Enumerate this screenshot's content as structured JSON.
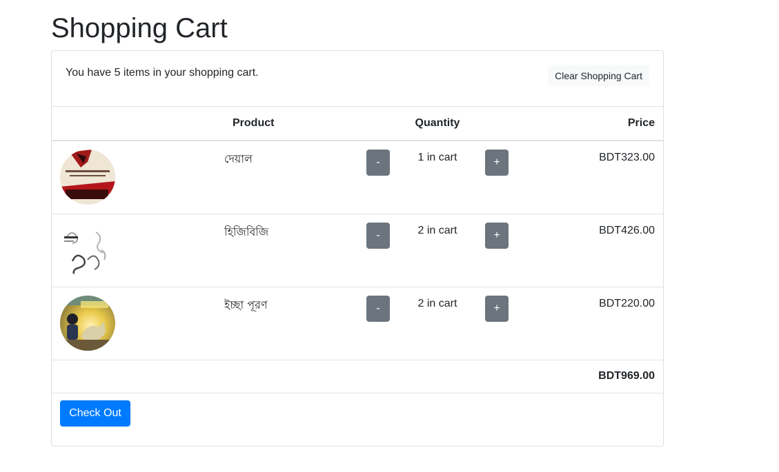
{
  "page": {
    "title": "Shopping Cart"
  },
  "cart": {
    "summary": "You have 5 items in your shopping cart.",
    "clear_label": "Clear Shopping Cart",
    "columns": {
      "product": "Product",
      "quantity": "Quantity",
      "price": "Price"
    },
    "items": [
      {
        "name": "দেয়াল",
        "quantity_text": "1 in cart",
        "price": "BDT323.00",
        "minus": "-",
        "plus": "+"
      },
      {
        "name": "হিজিবিজি",
        "quantity_text": "2 in cart",
        "price": "BDT426.00",
        "minus": "-",
        "plus": "+"
      },
      {
        "name": "ইচ্ছা পূরণ",
        "quantity_text": "2 in cart",
        "price": "BDT220.00",
        "minus": "-",
        "plus": "+"
      }
    ],
    "total": "BDT969.00",
    "checkout_label": "Check Out"
  }
}
